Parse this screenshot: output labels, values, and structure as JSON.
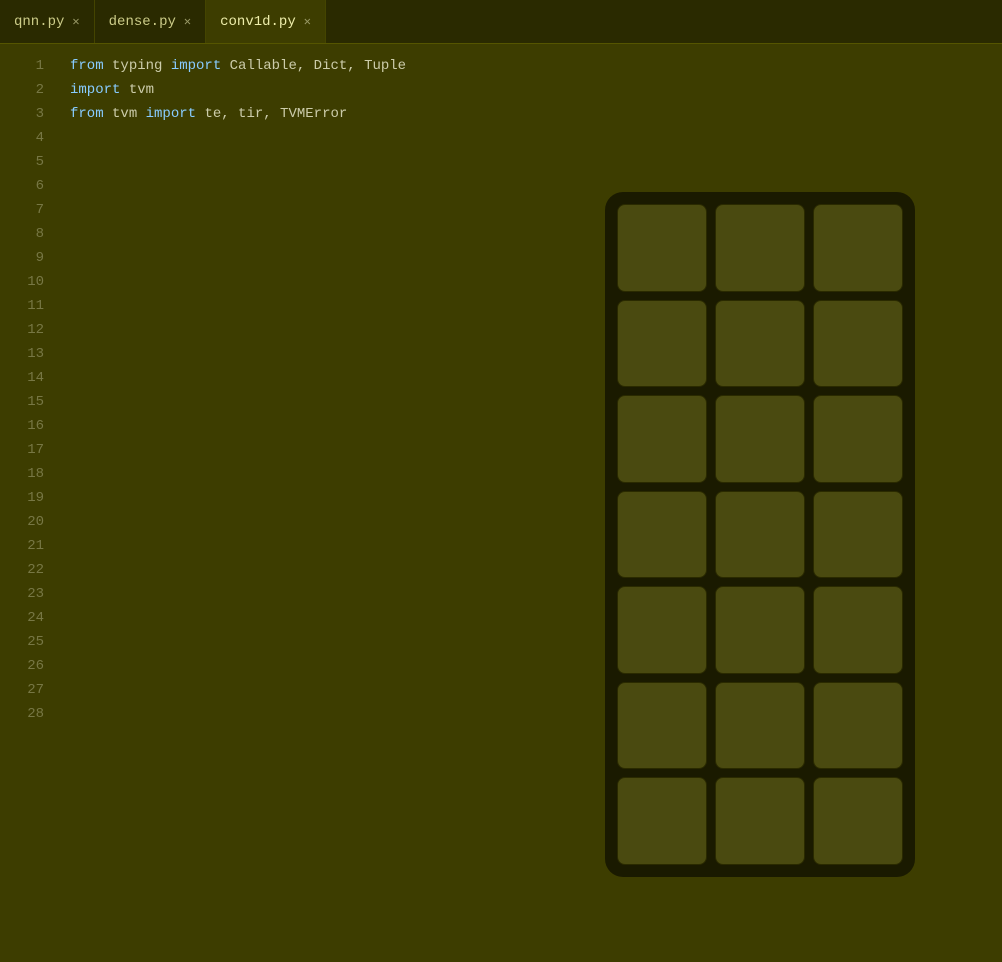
{
  "tabs": [
    {
      "id": "qnn",
      "label": "qnn.py",
      "active": false
    },
    {
      "id": "dense",
      "label": "dense.py",
      "active": false
    },
    {
      "id": "conv1d",
      "label": "conv1d.py",
      "active": true
    }
  ],
  "editor": {
    "lines": [
      {
        "num": 1,
        "tokens": [
          {
            "type": "kw",
            "text": "from"
          },
          {
            "type": "normal",
            "text": " typing "
          },
          {
            "type": "kw",
            "text": "import"
          },
          {
            "type": "normal",
            "text": " Callable, Dict, Tuple"
          }
        ]
      },
      {
        "num": 2,
        "tokens": [
          {
            "type": "kw",
            "text": "import"
          },
          {
            "type": "normal",
            "text": " tvm"
          }
        ]
      },
      {
        "num": 3,
        "tokens": [
          {
            "type": "kw",
            "text": "from"
          },
          {
            "type": "normal",
            "text": " tvm "
          },
          {
            "type": "kw",
            "text": "import"
          },
          {
            "type": "normal",
            "text": " te, tir, TVMError"
          }
        ]
      },
      {
        "num": 4,
        "tokens": []
      },
      {
        "num": 5,
        "tokens": []
      },
      {
        "num": 6,
        "tokens": []
      },
      {
        "num": 7,
        "tokens": []
      },
      {
        "num": 8,
        "tokens": []
      },
      {
        "num": 9,
        "tokens": []
      },
      {
        "num": 10,
        "tokens": []
      },
      {
        "num": 11,
        "tokens": []
      },
      {
        "num": 12,
        "tokens": []
      },
      {
        "num": 13,
        "tokens": []
      },
      {
        "num": 14,
        "tokens": []
      },
      {
        "num": 15,
        "tokens": []
      },
      {
        "num": 16,
        "tokens": []
      },
      {
        "num": 17,
        "tokens": []
      },
      {
        "num": 18,
        "tokens": []
      },
      {
        "num": 19,
        "tokens": []
      },
      {
        "num": 20,
        "tokens": []
      },
      {
        "num": 21,
        "tokens": []
      },
      {
        "num": 22,
        "tokens": []
      },
      {
        "num": 23,
        "tokens": []
      },
      {
        "num": 24,
        "tokens": []
      },
      {
        "num": 25,
        "tokens": []
      },
      {
        "num": 26,
        "tokens": []
      },
      {
        "num": 27,
        "tokens": []
      },
      {
        "num": 28,
        "tokens": []
      }
    ]
  },
  "grid": {
    "rows": 7,
    "cols": 3
  }
}
